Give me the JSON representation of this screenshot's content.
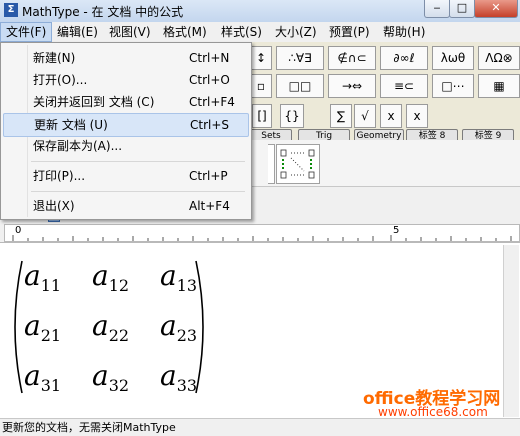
{
  "window": {
    "title": "MathType - 在 文档  中的公式",
    "app_icon_glyph": "Σ",
    "min_glyph": "‒",
    "max_glyph": "□",
    "close_glyph": "✕"
  },
  "menubar": [
    "文件(F)",
    "编辑(E)",
    "视图(V)",
    "格式(M)",
    "样式(S)",
    "大小(Z)",
    "预置(P)",
    "帮助(H)"
  ],
  "toolbar": {
    "row1": [
      "≤≠≈",
      "∴∀∃",
      "∉∩⊂",
      "∂∞ℓ",
      "λωθ",
      "ΛΩ⊗"
    ],
    "row2": [
      "□□",
      "→⇔",
      "≡⊂",
      "□⋯",
      "▦",
      "▦"
    ],
    "row3": [
      "[]",
      "{}",
      "∑",
      "√",
      "x",
      "x"
    ],
    "tabs": [
      "Sets",
      "Trig",
      "Geometry",
      "标签 8",
      "标签 9"
    ]
  },
  "file_menu": {
    "items": [
      {
        "label": "新建(N)",
        "shortcut": "Ctrl+N"
      },
      {
        "label": "打开(O)...",
        "shortcut": "Ctrl+O"
      },
      {
        "label": "关闭并返回到 文档 (C)",
        "shortcut": "Ctrl+F4"
      },
      {
        "label": "更新 文档 (U)",
        "shortcut": "Ctrl+S",
        "highlighted": true
      },
      {
        "label": "保存副本为(A)...",
        "shortcut": ""
      },
      {
        "label": "打印(P)...",
        "shortcut": "Ctrl+P"
      },
      {
        "label": "退出(X)",
        "shortcut": "Alt+F4"
      }
    ]
  },
  "ruler": {
    "mark_0": "0",
    "mark_5": "5"
  },
  "matrix": {
    "rows": [
      [
        {
          "base": "a",
          "sub": "11"
        },
        {
          "base": "a",
          "sub": "12"
        },
        {
          "base": "a",
          "sub": "13"
        }
      ],
      [
        {
          "base": "a",
          "sub": "21"
        },
        {
          "base": "a",
          "sub": "22"
        },
        {
          "base": "a",
          "sub": "23"
        }
      ],
      [
        {
          "base": "a",
          "sub": "31"
        },
        {
          "base": "a",
          "sub": "32"
        },
        {
          "base": "a",
          "sub": "33"
        }
      ]
    ]
  },
  "status_text": "更新您的文档，无需关闭MathType",
  "watermark": {
    "line1": "office教程学习网",
    "line2": "www.office68.com"
  },
  "colors": {
    "accent": "#2a5aa8",
    "highlight": "#d8e6f8",
    "watermark": "#ff6a00"
  }
}
